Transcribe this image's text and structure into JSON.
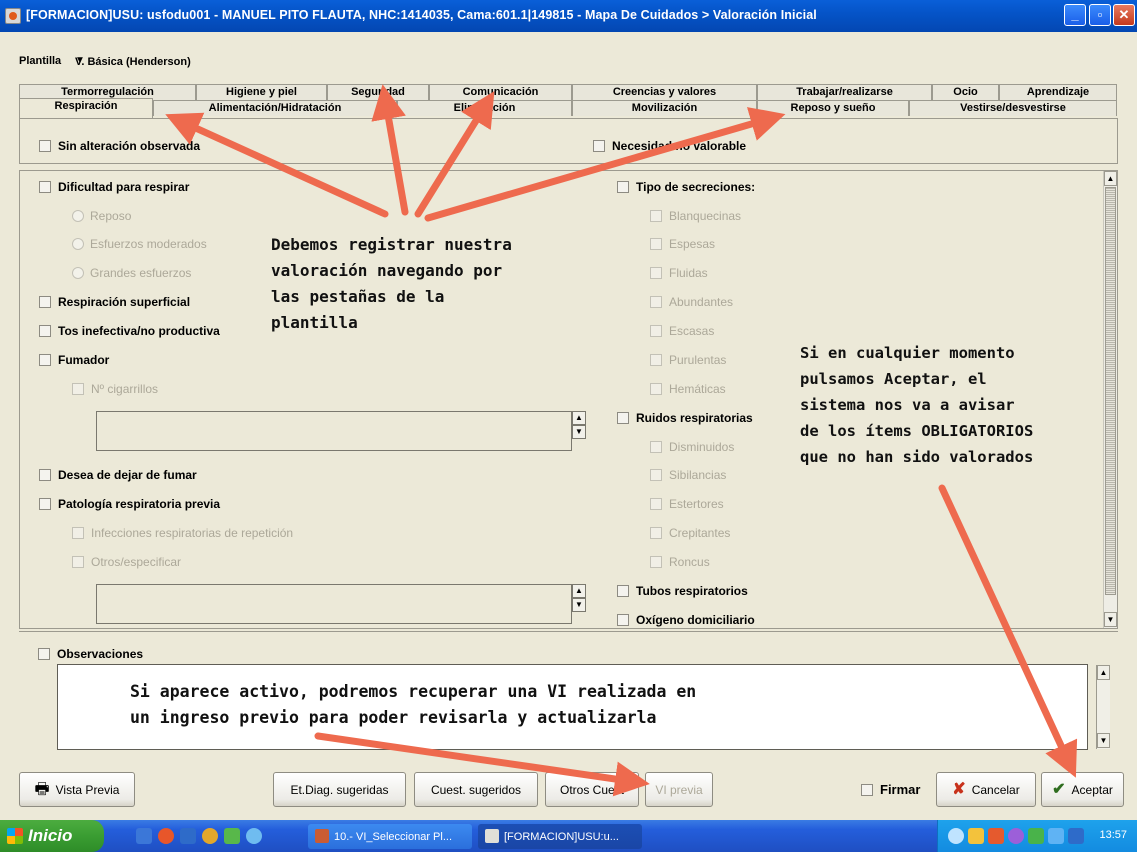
{
  "window": {
    "title": "[FORMACION]USU: usfodu001 - MANUEL PITO FLAUTA, NHC:1414035, Cama:601.1|149815 - Mapa De Cuidados > Valoración Inicial",
    "minimize": "_",
    "maximize": "▫",
    "close": "✕"
  },
  "plantilla": {
    "label": "Plantilla",
    "value": "V. Básica (Henderson)",
    "arrow": "▼"
  },
  "tabs_top": [
    "Termorregulación",
    "Higiene y piel",
    "Seguridad",
    "Comunicación",
    "Creencias y valores",
    "Trabajar/realizarse",
    "Ocio",
    "Aprendizaje"
  ],
  "tabs_bottom": [
    "Respiración",
    "Alimentación/Hidratación",
    "Eliminación",
    "Movilización",
    "Reposo y sueño",
    "Vestirse/desvestirse"
  ],
  "header_checks": {
    "no_alteration": "Sin alteración observada",
    "not_assessable": "Necesidad no valorable"
  },
  "left_column": {
    "dificultad": "Dificultad para respirar",
    "radios": [
      "Reposo",
      "Esfuerzos moderados",
      "Grandes esfuerzos"
    ],
    "superficial": "Respiración superficial",
    "tos": "Tos inefectiva/no productiva",
    "fumador": "Fumador",
    "cigarrillos": "Nº cigarrillos",
    "dejar": "Desea de dejar de fumar",
    "patologia": "Patología respiratoria previa",
    "infecciones": "Infecciones respiratorias de repetición",
    "otros": "Otros/especificar"
  },
  "right_column": {
    "secreciones": "Tipo de secreciones:",
    "secreciones_items": [
      "Blanquecinas",
      "Espesas",
      "Fluidas",
      "Abundantes",
      "Escasas",
      "Purulentas",
      "Hemáticas"
    ],
    "ruidos": "Ruidos respiratorias",
    "ruidos_items": [
      "Disminuidos",
      "Sibilancias",
      "Estertores",
      "Crepitantes",
      "Roncus"
    ],
    "tubos": "Tubos respiratorios",
    "oxigeno": "Oxígeno domiciliario"
  },
  "observaciones": {
    "label": "Observaciones"
  },
  "annotations": {
    "tabs_note": [
      "Debemos registrar nuestra",
      "valoración navegando por",
      "las pestañas de la",
      "plantilla"
    ],
    "accept_note": [
      "Si en cualquier momento",
      "pulsamos Aceptar, el",
      "sistema nos va a avisar",
      "de los ítems OBLIGATORIOS",
      "que no han sido valorados"
    ],
    "previous_note": [
      "Si aparece activo, podremos recuperar una VI realizada en",
      "un ingreso previo para poder revisarla y actualizarla"
    ]
  },
  "buttons": {
    "vista_previa": "Vista Previa",
    "et_diag": "Et.Diag. sugeridas",
    "cuest_sugeridos": "Cuest. sugeridos",
    "otros_cuest": "Otros Cuest",
    "vi_previa": "VI previa",
    "firmar": "Firmar",
    "cancelar": "Cancelar",
    "aceptar": "Aceptar"
  },
  "taskbar": {
    "start": "Inicio",
    "task1": "10.- VI_Seleccionar Pl...",
    "task2": "[FORMACION]USU:u...",
    "clock": "13:57"
  },
  "colors": {
    "arrow": "#ee6a4e",
    "titlebar": "#0554c8",
    "taskbar": "#245edb"
  }
}
